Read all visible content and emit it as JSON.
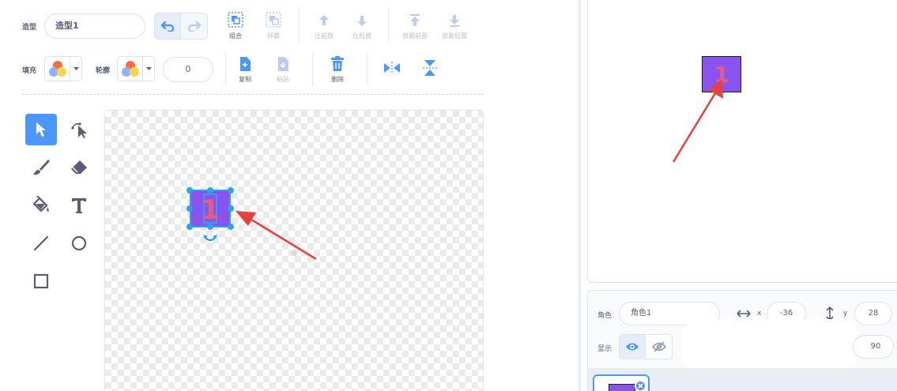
{
  "toolbar": {
    "costume_label": "造型",
    "costume_name": "造型1",
    "group_label": "组合",
    "ungroup_label": "拆散",
    "forward_label": "往前放",
    "backward_label": "往后放",
    "front_label": "放最前面",
    "back_label": "放最后面",
    "fill_label": "填充",
    "outline_label": "轮廓",
    "outline_width": "0",
    "copy_label": "复制",
    "paste_label": "粘贴",
    "delete_label": "删除"
  },
  "canvas": {
    "sprite_text": "1"
  },
  "stage": {
    "sprite_text": "1"
  },
  "sprite_info": {
    "sprite_label": "角色",
    "sprite_name": "角色1",
    "x_label": "x",
    "x_value": "-36",
    "y_label": "y",
    "y_value": "28",
    "show_label": "显示",
    "direction_value": "90"
  },
  "colors": {
    "accent": "#4c97ff",
    "sprite_fill": "#8a53f0",
    "sprite_digit": "#e85b7a",
    "annotation_arrow": "#e8403a"
  },
  "icons": {
    "undo": "undo-icon",
    "redo": "redo-icon",
    "group": "group-icon",
    "ungroup": "ungroup-icon",
    "forward": "arrow-up-icon",
    "backward": "arrow-down-icon",
    "front": "bring-front-icon",
    "back": "send-back-icon",
    "copy": "copy-icon",
    "paste": "paste-icon",
    "delete": "trash-icon",
    "flip_h": "flip-horizontal-icon",
    "flip_v": "flip-vertical-icon"
  }
}
